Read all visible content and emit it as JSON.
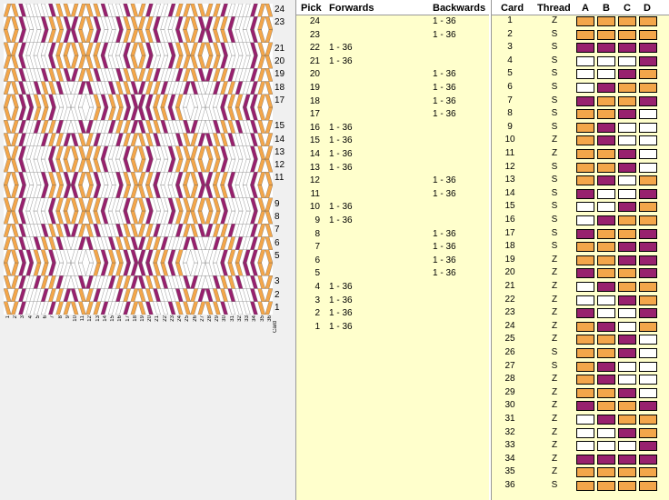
{
  "colors": {
    "orange": "#f3a64a",
    "purple": "#98216e",
    "white": "#ffffff",
    "panel_bg": "#ffffcc"
  },
  "pattern": {
    "row_labels": [
      "24",
      "23",
      "21",
      "20",
      "19",
      "18",
      "17",
      "15",
      "14",
      "13",
      "12",
      "11",
      "9",
      "8",
      "7",
      "6",
      "5",
      "3",
      "2",
      "1"
    ],
    "card_labels": [
      "1",
      "2",
      "3",
      "4",
      "5",
      "6",
      "7",
      "8",
      "9",
      "10",
      "11",
      "12",
      "13",
      "14",
      "15",
      "16",
      "17",
      "18",
      "19",
      "20",
      "21",
      "22",
      "23",
      "24",
      "25",
      "26",
      "27",
      "28",
      "29",
      "30",
      "31",
      "32",
      "33",
      "34",
      "35",
      "36"
    ],
    "card_caption": "Card"
  },
  "picks": {
    "headers": {
      "pick": "Pick",
      "forwards": "Forwards",
      "backwards": "Backwards"
    },
    "rows": [
      {
        "n": "24",
        "fw": "",
        "bw": "1 - 36"
      },
      {
        "n": "23",
        "fw": "",
        "bw": "1 - 36"
      },
      {
        "n": "22",
        "fw": "1 - 36",
        "bw": ""
      },
      {
        "n": "21",
        "fw": "1 - 36",
        "bw": ""
      },
      {
        "n": "20",
        "fw": "",
        "bw": "1 - 36"
      },
      {
        "n": "19",
        "fw": "",
        "bw": "1 - 36"
      },
      {
        "n": "18",
        "fw": "",
        "bw": "1 - 36"
      },
      {
        "n": "17",
        "fw": "",
        "bw": "1 - 36"
      },
      {
        "n": "16",
        "fw": "1 - 36",
        "bw": ""
      },
      {
        "n": "15",
        "fw": "1 - 36",
        "bw": ""
      },
      {
        "n": "14",
        "fw": "1 - 36",
        "bw": ""
      },
      {
        "n": "13",
        "fw": "1 - 36",
        "bw": ""
      },
      {
        "n": "12",
        "fw": "",
        "bw": "1 - 36"
      },
      {
        "n": "11",
        "fw": "",
        "bw": "1 - 36"
      },
      {
        "n": "10",
        "fw": "1 - 36",
        "bw": ""
      },
      {
        "n": "9",
        "fw": "1 - 36",
        "bw": ""
      },
      {
        "n": "8",
        "fw": "",
        "bw": "1 - 36"
      },
      {
        "n": "7",
        "fw": "",
        "bw": "1 - 36"
      },
      {
        "n": "6",
        "fw": "",
        "bw": "1 - 36"
      },
      {
        "n": "5",
        "fw": "",
        "bw": "1 - 36"
      },
      {
        "n": "4",
        "fw": "1 - 36",
        "bw": ""
      },
      {
        "n": "3",
        "fw": "1 - 36",
        "bw": ""
      },
      {
        "n": "2",
        "fw": "1 - 36",
        "bw": ""
      },
      {
        "n": "1",
        "fw": "1 - 36",
        "bw": ""
      }
    ]
  },
  "cards": {
    "headers": {
      "card": "Card",
      "thread": "Thread",
      "a": "A",
      "b": "B",
      "c": "C",
      "d": "D"
    },
    "rows": [
      {
        "n": "1",
        "t": "Z",
        "h": [
          "O",
          "O",
          "O",
          "O"
        ]
      },
      {
        "n": "2",
        "t": "S",
        "h": [
          "O",
          "O",
          "O",
          "O"
        ]
      },
      {
        "n": "3",
        "t": "S",
        "h": [
          "P",
          "P",
          "P",
          "P"
        ]
      },
      {
        "n": "4",
        "t": "S",
        "h": [
          "W",
          "W",
          "W",
          "P"
        ]
      },
      {
        "n": "5",
        "t": "S",
        "h": [
          "W",
          "W",
          "P",
          "O"
        ]
      },
      {
        "n": "6",
        "t": "S",
        "h": [
          "W",
          "P",
          "O",
          "O"
        ]
      },
      {
        "n": "7",
        "t": "S",
        "h": [
          "P",
          "O",
          "O",
          "P"
        ]
      },
      {
        "n": "8",
        "t": "S",
        "h": [
          "O",
          "O",
          "P",
          "W"
        ]
      },
      {
        "n": "9",
        "t": "S",
        "h": [
          "O",
          "P",
          "W",
          "W"
        ]
      },
      {
        "n": "10",
        "t": "Z",
        "h": [
          "O",
          "P",
          "W",
          "W"
        ]
      },
      {
        "n": "11",
        "t": "Z",
        "h": [
          "O",
          "O",
          "P",
          "W"
        ]
      },
      {
        "n": "12",
        "t": "S",
        "h": [
          "O",
          "O",
          "P",
          "W"
        ]
      },
      {
        "n": "13",
        "t": "S",
        "h": [
          "O",
          "P",
          "W",
          "O"
        ]
      },
      {
        "n": "14",
        "t": "S",
        "h": [
          "P",
          "W",
          "W",
          "P"
        ]
      },
      {
        "n": "15",
        "t": "S",
        "h": [
          "W",
          "W",
          "P",
          "O"
        ]
      },
      {
        "n": "16",
        "t": "S",
        "h": [
          "W",
          "P",
          "O",
          "O"
        ]
      },
      {
        "n": "17",
        "t": "S",
        "h": [
          "P",
          "O",
          "O",
          "P"
        ]
      },
      {
        "n": "18",
        "t": "S",
        "h": [
          "O",
          "O",
          "P",
          "P"
        ]
      },
      {
        "n": "19",
        "t": "Z",
        "h": [
          "O",
          "O",
          "P",
          "P"
        ]
      },
      {
        "n": "20",
        "t": "Z",
        "h": [
          "P",
          "O",
          "O",
          "P"
        ]
      },
      {
        "n": "21",
        "t": "Z",
        "h": [
          "W",
          "P",
          "O",
          "O"
        ]
      },
      {
        "n": "22",
        "t": "Z",
        "h": [
          "W",
          "W",
          "P",
          "O"
        ]
      },
      {
        "n": "23",
        "t": "Z",
        "h": [
          "P",
          "W",
          "W",
          "P"
        ]
      },
      {
        "n": "24",
        "t": "Z",
        "h": [
          "O",
          "P",
          "W",
          "O"
        ]
      },
      {
        "n": "25",
        "t": "Z",
        "h": [
          "O",
          "O",
          "P",
          "W"
        ]
      },
      {
        "n": "26",
        "t": "S",
        "h": [
          "O",
          "O",
          "P",
          "W"
        ]
      },
      {
        "n": "27",
        "t": "S",
        "h": [
          "O",
          "P",
          "W",
          "W"
        ]
      },
      {
        "n": "28",
        "t": "Z",
        "h": [
          "O",
          "P",
          "W",
          "W"
        ]
      },
      {
        "n": "29",
        "t": "Z",
        "h": [
          "O",
          "O",
          "P",
          "W"
        ]
      },
      {
        "n": "30",
        "t": "Z",
        "h": [
          "P",
          "O",
          "O",
          "P"
        ]
      },
      {
        "n": "31",
        "t": "Z",
        "h": [
          "W",
          "P",
          "O",
          "O"
        ]
      },
      {
        "n": "32",
        "t": "Z",
        "h": [
          "W",
          "W",
          "P",
          "O"
        ]
      },
      {
        "n": "33",
        "t": "Z",
        "h": [
          "W",
          "W",
          "W",
          "P"
        ]
      },
      {
        "n": "34",
        "t": "Z",
        "h": [
          "P",
          "P",
          "P",
          "P"
        ]
      },
      {
        "n": "35",
        "t": "Z",
        "h": [
          "O",
          "O",
          "O",
          "O"
        ]
      },
      {
        "n": "36",
        "t": "S",
        "h": [
          "O",
          "O",
          "O",
          "O"
        ]
      }
    ]
  }
}
